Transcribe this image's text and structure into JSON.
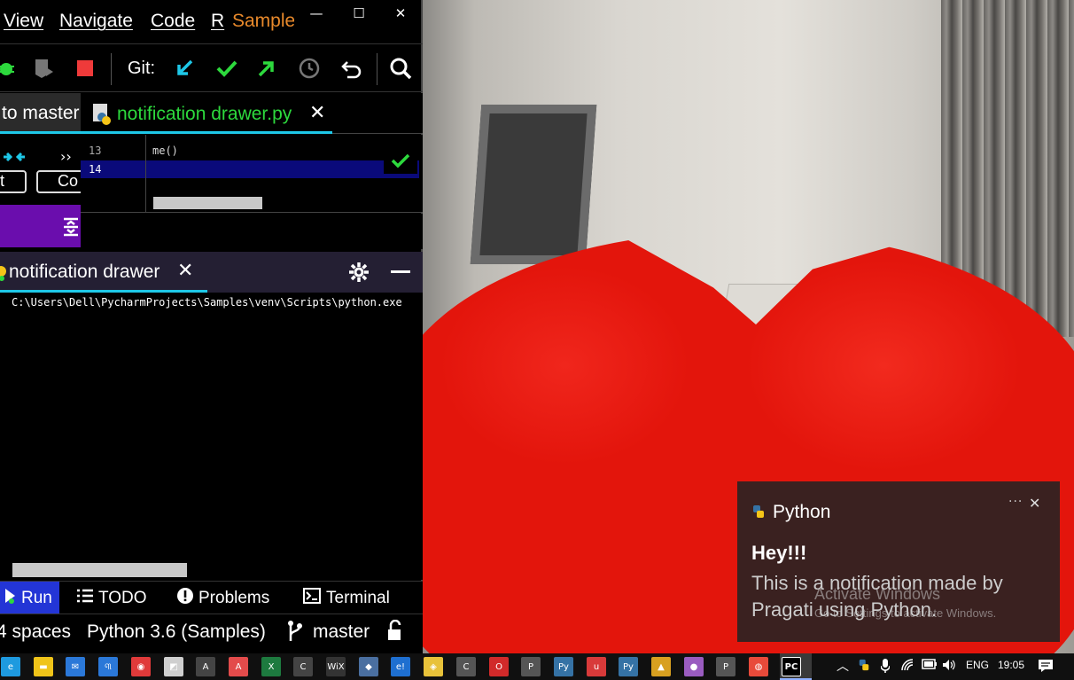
{
  "menu": {
    "view": "View",
    "navigate": "Navigate",
    "code": "Code",
    "refactor_partial": "R",
    "project_title": "Sample"
  },
  "window_controls": {
    "minimize": "—",
    "maximize": "☐",
    "close": "✕"
  },
  "toolbar": {
    "git_label": "Git:"
  },
  "left_panel": {
    "branch_tab_label": "to master",
    "commit_btn_partial": "Co",
    "t_partial": "t",
    "more": "››"
  },
  "editor": {
    "tab_label": "notification drawer.py",
    "tab_close": "✕",
    "line_numbers": [
      "13",
      "14"
    ],
    "code_line_13": "me()"
  },
  "run_window": {
    "tab_label": "notification drawer",
    "tab_close": "✕",
    "console_line": "C:\\Users\\Dell\\PycharmProjects\\Samples\\venv\\Scripts\\python.exe"
  },
  "tool_tabs": {
    "run": "Run",
    "todo": "TODO",
    "problems": "Problems",
    "terminal": "Terminal"
  },
  "status_bar": {
    "indent": "4 spaces",
    "interpreter": "Python 3.6 (Samples)",
    "branch": "master"
  },
  "notification": {
    "app_name": "Python",
    "more": "···",
    "close": "✕",
    "title": "Hey!!!",
    "body": "This is a notification made by Pragati using Python."
  },
  "watermark": {
    "line1": "Activate Windows",
    "line2": "Go to Settings to activate Windows."
  },
  "taskbar": {
    "apps": [
      {
        "name": "edge-icon",
        "glyph": "e",
        "color": "#1e9adf"
      },
      {
        "name": "file-explorer-icon",
        "glyph": "▬",
        "color": "#f0c419"
      },
      {
        "name": "mail-icon",
        "glyph": "✉",
        "color": "#2b78d8"
      },
      {
        "name": "app-icon-1",
        "glyph": "୩",
        "color": "#2b78d8"
      },
      {
        "name": "app-icon-2",
        "glyph": "◉",
        "color": "#e03a3a"
      },
      {
        "name": "app-icon-3",
        "glyph": "◩",
        "color": "#cfcfcf"
      },
      {
        "name": "app-icon-4",
        "glyph": "A",
        "color": "#444444"
      },
      {
        "name": "acrobat-icon",
        "glyph": "A",
        "color": "#e34b4b"
      },
      {
        "name": "excel-icon",
        "glyph": "X",
        "color": "#1d7a3f"
      },
      {
        "name": "app-icon-5",
        "glyph": "C",
        "color": "#444444"
      },
      {
        "name": "wix-icon",
        "glyph": "WiX",
        "color": "#333333"
      },
      {
        "name": "app-icon-6",
        "glyph": "◆",
        "color": "#4a6fa0"
      },
      {
        "name": "ie-icon",
        "glyph": "e!",
        "color": "#1e6fd0"
      },
      {
        "name": "app-icon-7",
        "glyph": "◈",
        "color": "#e8c23a"
      },
      {
        "name": "app-icon-8",
        "glyph": "C",
        "color": "#555555"
      },
      {
        "name": "opera-icon",
        "glyph": "O",
        "color": "#d12a2a"
      },
      {
        "name": "app-icon-9",
        "glyph": "P",
        "color": "#555555"
      },
      {
        "name": "python-icon",
        "glyph": "Py",
        "color": "#3572a5"
      },
      {
        "name": "app-icon-10",
        "glyph": "u",
        "color": "#d83a3a"
      },
      {
        "name": "python-idle-icon",
        "glyph": "Py",
        "color": "#3572a5"
      },
      {
        "name": "app-icon-11",
        "glyph": "▲",
        "color": "#d8a020"
      },
      {
        "name": "app-icon-12",
        "glyph": "●",
        "color": "#9a5cc0"
      },
      {
        "name": "app-icon-13",
        "glyph": "P",
        "color": "#555555"
      },
      {
        "name": "chrome-icon",
        "glyph": "◍",
        "color": "#e84a3a"
      },
      {
        "name": "pycharm-icon",
        "glyph": "PC",
        "color": "#000000"
      }
    ],
    "language": "ENG",
    "time": "19:05"
  },
  "colors": {
    "accent_tab": "#1ec8e8",
    "file_tab_text": "#2dd93d",
    "project_title": "#e8892b",
    "run_button_bg": "#2335d6",
    "purple_bar": "#6a0dad",
    "heart_red": "#e3150c"
  }
}
